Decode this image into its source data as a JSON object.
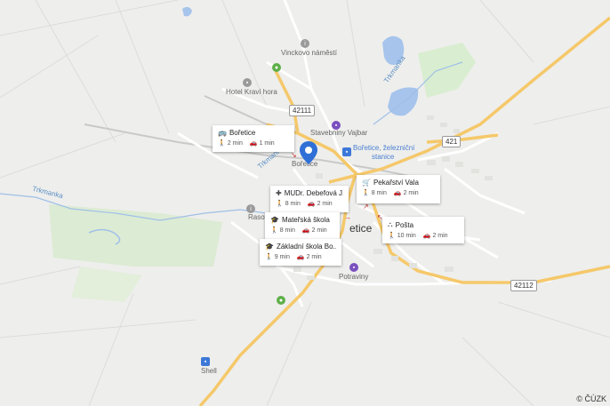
{
  "map": {
    "places": {
      "vinckovo": "Vinckovo náměstí",
      "hotel": "Hotel Kraví hora",
      "stavebniny": "Stavebniny Vajbar",
      "nadrazi_line1": "Bořetice, železniční",
      "nadrazi_line2": "stanice",
      "boretice_small": "Bořetice",
      "rasov": "Rasov",
      "potraviny": "Potraviny",
      "shell": "Shell",
      "town": "etice"
    },
    "water": {
      "trkmanka_west": "Trkmanka",
      "trkmanka_east": "Trkmanka",
      "trkmanka_mid": "Trkmanka"
    },
    "roads": {
      "r1": "42111",
      "r2": "421",
      "r3": "42112"
    }
  },
  "cards": [
    {
      "title": "Bořetice",
      "icon": "bus-icon",
      "walk": "2 min",
      "car": "1 min"
    },
    {
      "title": "MUDr. Debefová J...",
      "icon": "medical-icon",
      "walk": "8 min",
      "car": "2 min"
    },
    {
      "title": "Mateřská škola",
      "icon": "school-icon",
      "walk": "8 min",
      "car": "2 min"
    },
    {
      "title": "Základní škola Bo...",
      "icon": "school-icon",
      "walk": "9 min",
      "car": "2 min"
    },
    {
      "title": "Pekařství Vala",
      "icon": "cart-icon",
      "walk": "8 min",
      "car": "2 min"
    },
    {
      "title": "Pošta",
      "icon": "post-icon",
      "walk": "10 min",
      "car": "2 min"
    }
  ],
  "copyright": "© ČÚZK",
  "colors": {
    "background": "#eeeeec",
    "road_major": "#f5c86a",
    "road_minor": "#ffffff",
    "water": "#a6c4ec",
    "green": "#d6ecc8",
    "marker": "#2f6fd6"
  }
}
